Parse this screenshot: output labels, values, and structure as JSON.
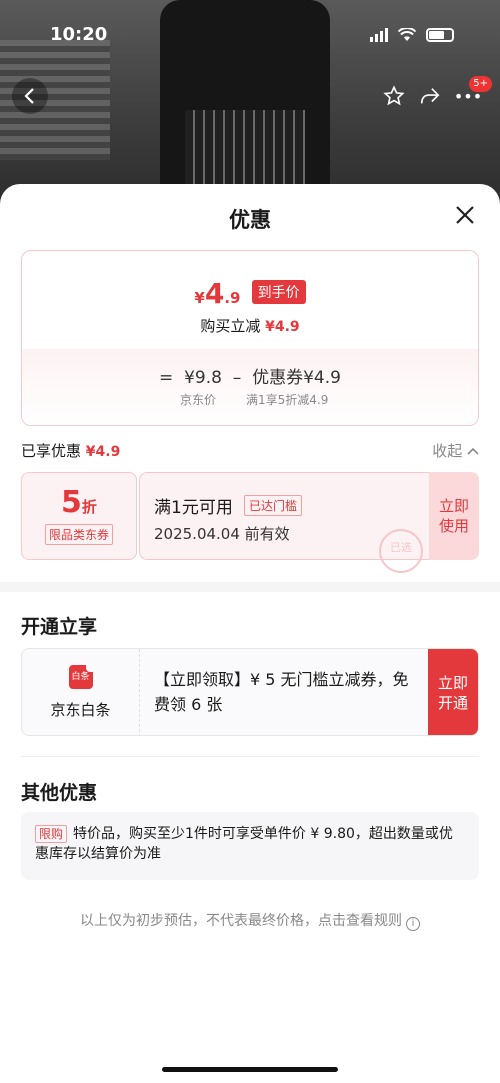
{
  "status_bar": {
    "time": "10:20"
  },
  "header": {
    "badge": "5+"
  },
  "sheet": {
    "title": "优惠"
  },
  "price": {
    "yen": "¥",
    "amount_int": "4",
    "amount_dec": ".9",
    "tag": "到手价",
    "reduce_label": "购买立减",
    "reduce_value": "¥4.9",
    "formula_eq": "=",
    "formula_price": "¥9.8",
    "formula_minus": "–",
    "formula_coupon_label": "优惠券",
    "formula_coupon_value": "¥4.9",
    "sub_price_label": "京东价",
    "sub_coupon_label": "满1享5折减4.9"
  },
  "enjoyed": {
    "label": "已享优惠",
    "value": "¥4.9",
    "collapse": "收起"
  },
  "coupon": {
    "discount": "5",
    "discount_unit": "折",
    "category": "限品类东券",
    "condition": "满1元可用",
    "reached": "已达门槛",
    "expiry": "2025.04.04 前有效",
    "stamp": "已选",
    "button": "立即使用"
  },
  "open_section": {
    "title": "开通立享",
    "brand_icon": "白条",
    "brand": "京东白条",
    "offer": "【立即领取】¥ 5 无门槛立减券，免费领 6 张",
    "button": "立即开通"
  },
  "other_section": {
    "title": "其他优惠",
    "tag": "限购",
    "text": "特价品，购买至少1件时可享受单件价 ¥ 9.80，超出数量或优惠库存以结算价为准"
  },
  "footnote": "以上仅为初步预估，不代表最终价格，点击查看规则",
  "colors": {
    "accent": "#e4393c"
  }
}
